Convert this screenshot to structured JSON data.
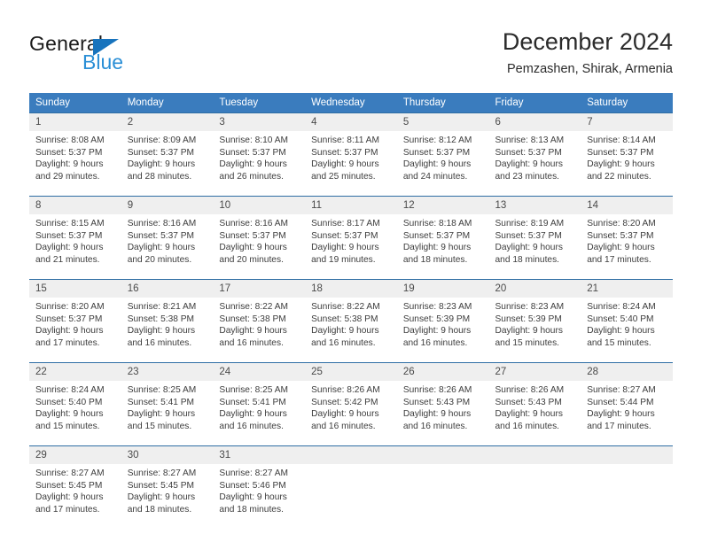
{
  "brand": {
    "name_part1": "General",
    "name_part2": "Blue",
    "triangle_color": "#1773bd",
    "blue_color": "#2b8fd6"
  },
  "header": {
    "title": "December 2024",
    "subtitle": "Pemzashen, Shirak, Armenia"
  },
  "theme": {
    "header_bg": "#3a7cbe",
    "row_divider": "#2e6da4",
    "daynum_bg": "#efefef",
    "text": "#3d3d3d"
  },
  "weekday_headers": [
    "Sunday",
    "Monday",
    "Tuesday",
    "Wednesday",
    "Thursday",
    "Friday",
    "Saturday"
  ],
  "weeks": [
    [
      {
        "day": "1",
        "sunrise": "Sunrise: 8:08 AM",
        "sunset": "Sunset: 5:37 PM",
        "daylight_line1": "Daylight: 9 hours",
        "daylight_line2": "and 29 minutes."
      },
      {
        "day": "2",
        "sunrise": "Sunrise: 8:09 AM",
        "sunset": "Sunset: 5:37 PM",
        "daylight_line1": "Daylight: 9 hours",
        "daylight_line2": "and 28 minutes."
      },
      {
        "day": "3",
        "sunrise": "Sunrise: 8:10 AM",
        "sunset": "Sunset: 5:37 PM",
        "daylight_line1": "Daylight: 9 hours",
        "daylight_line2": "and 26 minutes."
      },
      {
        "day": "4",
        "sunrise": "Sunrise: 8:11 AM",
        "sunset": "Sunset: 5:37 PM",
        "daylight_line1": "Daylight: 9 hours",
        "daylight_line2": "and 25 minutes."
      },
      {
        "day": "5",
        "sunrise": "Sunrise: 8:12 AM",
        "sunset": "Sunset: 5:37 PM",
        "daylight_line1": "Daylight: 9 hours",
        "daylight_line2": "and 24 minutes."
      },
      {
        "day": "6",
        "sunrise": "Sunrise: 8:13 AM",
        "sunset": "Sunset: 5:37 PM",
        "daylight_line1": "Daylight: 9 hours",
        "daylight_line2": "and 23 minutes."
      },
      {
        "day": "7",
        "sunrise": "Sunrise: 8:14 AM",
        "sunset": "Sunset: 5:37 PM",
        "daylight_line1": "Daylight: 9 hours",
        "daylight_line2": "and 22 minutes."
      }
    ],
    [
      {
        "day": "8",
        "sunrise": "Sunrise: 8:15 AM",
        "sunset": "Sunset: 5:37 PM",
        "daylight_line1": "Daylight: 9 hours",
        "daylight_line2": "and 21 minutes."
      },
      {
        "day": "9",
        "sunrise": "Sunrise: 8:16 AM",
        "sunset": "Sunset: 5:37 PM",
        "daylight_line1": "Daylight: 9 hours",
        "daylight_line2": "and 20 minutes."
      },
      {
        "day": "10",
        "sunrise": "Sunrise: 8:16 AM",
        "sunset": "Sunset: 5:37 PM",
        "daylight_line1": "Daylight: 9 hours",
        "daylight_line2": "and 20 minutes."
      },
      {
        "day": "11",
        "sunrise": "Sunrise: 8:17 AM",
        "sunset": "Sunset: 5:37 PM",
        "daylight_line1": "Daylight: 9 hours",
        "daylight_line2": "and 19 minutes."
      },
      {
        "day": "12",
        "sunrise": "Sunrise: 8:18 AM",
        "sunset": "Sunset: 5:37 PM",
        "daylight_line1": "Daylight: 9 hours",
        "daylight_line2": "and 18 minutes."
      },
      {
        "day": "13",
        "sunrise": "Sunrise: 8:19 AM",
        "sunset": "Sunset: 5:37 PM",
        "daylight_line1": "Daylight: 9 hours",
        "daylight_line2": "and 18 minutes."
      },
      {
        "day": "14",
        "sunrise": "Sunrise: 8:20 AM",
        "sunset": "Sunset: 5:37 PM",
        "daylight_line1": "Daylight: 9 hours",
        "daylight_line2": "and 17 minutes."
      }
    ],
    [
      {
        "day": "15",
        "sunrise": "Sunrise: 8:20 AM",
        "sunset": "Sunset: 5:37 PM",
        "daylight_line1": "Daylight: 9 hours",
        "daylight_line2": "and 17 minutes."
      },
      {
        "day": "16",
        "sunrise": "Sunrise: 8:21 AM",
        "sunset": "Sunset: 5:38 PM",
        "daylight_line1": "Daylight: 9 hours",
        "daylight_line2": "and 16 minutes."
      },
      {
        "day": "17",
        "sunrise": "Sunrise: 8:22 AM",
        "sunset": "Sunset: 5:38 PM",
        "daylight_line1": "Daylight: 9 hours",
        "daylight_line2": "and 16 minutes."
      },
      {
        "day": "18",
        "sunrise": "Sunrise: 8:22 AM",
        "sunset": "Sunset: 5:38 PM",
        "daylight_line1": "Daylight: 9 hours",
        "daylight_line2": "and 16 minutes."
      },
      {
        "day": "19",
        "sunrise": "Sunrise: 8:23 AM",
        "sunset": "Sunset: 5:39 PM",
        "daylight_line1": "Daylight: 9 hours",
        "daylight_line2": "and 16 minutes."
      },
      {
        "day": "20",
        "sunrise": "Sunrise: 8:23 AM",
        "sunset": "Sunset: 5:39 PM",
        "daylight_line1": "Daylight: 9 hours",
        "daylight_line2": "and 15 minutes."
      },
      {
        "day": "21",
        "sunrise": "Sunrise: 8:24 AM",
        "sunset": "Sunset: 5:40 PM",
        "daylight_line1": "Daylight: 9 hours",
        "daylight_line2": "and 15 minutes."
      }
    ],
    [
      {
        "day": "22",
        "sunrise": "Sunrise: 8:24 AM",
        "sunset": "Sunset: 5:40 PM",
        "daylight_line1": "Daylight: 9 hours",
        "daylight_line2": "and 15 minutes."
      },
      {
        "day": "23",
        "sunrise": "Sunrise: 8:25 AM",
        "sunset": "Sunset: 5:41 PM",
        "daylight_line1": "Daylight: 9 hours",
        "daylight_line2": "and 15 minutes."
      },
      {
        "day": "24",
        "sunrise": "Sunrise: 8:25 AM",
        "sunset": "Sunset: 5:41 PM",
        "daylight_line1": "Daylight: 9 hours",
        "daylight_line2": "and 16 minutes."
      },
      {
        "day": "25",
        "sunrise": "Sunrise: 8:26 AM",
        "sunset": "Sunset: 5:42 PM",
        "daylight_line1": "Daylight: 9 hours",
        "daylight_line2": "and 16 minutes."
      },
      {
        "day": "26",
        "sunrise": "Sunrise: 8:26 AM",
        "sunset": "Sunset: 5:43 PM",
        "daylight_line1": "Daylight: 9 hours",
        "daylight_line2": "and 16 minutes."
      },
      {
        "day": "27",
        "sunrise": "Sunrise: 8:26 AM",
        "sunset": "Sunset: 5:43 PM",
        "daylight_line1": "Daylight: 9 hours",
        "daylight_line2": "and 16 minutes."
      },
      {
        "day": "28",
        "sunrise": "Sunrise: 8:27 AM",
        "sunset": "Sunset: 5:44 PM",
        "daylight_line1": "Daylight: 9 hours",
        "daylight_line2": "and 17 minutes."
      }
    ],
    [
      {
        "day": "29",
        "sunrise": "Sunrise: 8:27 AM",
        "sunset": "Sunset: 5:45 PM",
        "daylight_line1": "Daylight: 9 hours",
        "daylight_line2": "and 17 minutes."
      },
      {
        "day": "30",
        "sunrise": "Sunrise: 8:27 AM",
        "sunset": "Sunset: 5:45 PM",
        "daylight_line1": "Daylight: 9 hours",
        "daylight_line2": "and 18 minutes."
      },
      {
        "day": "31",
        "sunrise": "Sunrise: 8:27 AM",
        "sunset": "Sunset: 5:46 PM",
        "daylight_line1": "Daylight: 9 hours",
        "daylight_line2": "and 18 minutes."
      },
      {
        "day": "",
        "sunrise": "",
        "sunset": "",
        "daylight_line1": "",
        "daylight_line2": ""
      },
      {
        "day": "",
        "sunrise": "",
        "sunset": "",
        "daylight_line1": "",
        "daylight_line2": ""
      },
      {
        "day": "",
        "sunrise": "",
        "sunset": "",
        "daylight_line1": "",
        "daylight_line2": ""
      },
      {
        "day": "",
        "sunrise": "",
        "sunset": "",
        "daylight_line1": "",
        "daylight_line2": ""
      }
    ]
  ]
}
